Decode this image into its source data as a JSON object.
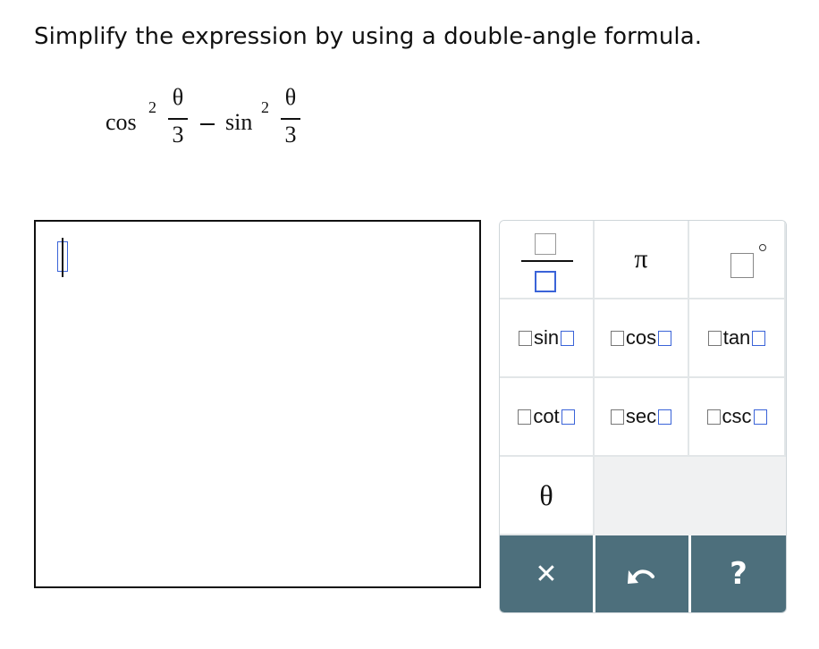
{
  "question": {
    "prompt": "Simplify the expression by using a double-angle formula.",
    "expression": {
      "term1_fn": "cos",
      "term1_power": "2",
      "term1_num": "θ",
      "term1_den": "3",
      "term2_fn": "sin",
      "term2_power": "2",
      "term2_num": "θ",
      "term2_den": "3"
    }
  },
  "keypad": {
    "fraction_key": "fraction",
    "pi_key": "π",
    "degree_key": "degree",
    "trig_row1": [
      "sin",
      "cos",
      "tan"
    ],
    "trig_row2": [
      "cot",
      "sec",
      "csc"
    ],
    "theta_key": "θ",
    "clear_key": "✕",
    "help_key": "?"
  },
  "colors": {
    "accent": "#3a63d8",
    "toolbar": "#4d6f7c"
  }
}
